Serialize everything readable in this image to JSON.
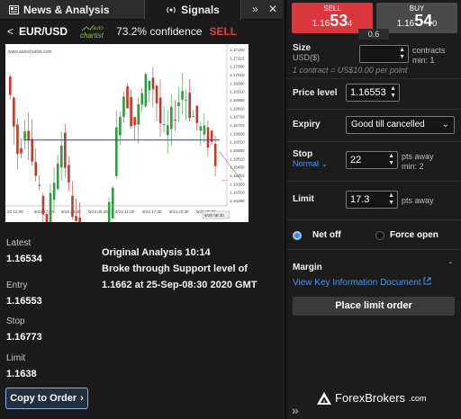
{
  "tabs": {
    "news": "News & Analysis",
    "signals": "Signals",
    "collapse": "»",
    "close": "✕"
  },
  "signal": {
    "back": "<",
    "pair": "EUR/USD",
    "logo_top": "auto",
    "logo_bottom": "chartist",
    "confidence": "73.2% confidence",
    "direction": "SELL"
  },
  "chart": {
    "watermark": "www.autochartist.com",
    "x_labels": [
      "23 12:00",
      "9/23 17:30",
      "9/23 23:30",
      "9/24 05:30",
      "9/24 11:30",
      "9/24 17:30",
      "9/24 23:30",
      "9/25 05:30"
    ],
    "y_labels": [
      "1.17160",
      "1.17110",
      "1.17060",
      "1.17010",
      "1.16960",
      "1.16910",
      "1.16860",
      "1.16810",
      "1.16760",
      "1.16710",
      "1.16660",
      "1.16610",
      "1.16560",
      "1.16510",
      "1.16460",
      "1.16410",
      "1.16360",
      "1.16310",
      "1.16260"
    ],
    "cursor_label": "9/25 08:30"
  },
  "stats": [
    {
      "label": "Latest",
      "value": "1.16534"
    },
    {
      "label": "Entry",
      "value": "1.16553"
    },
    {
      "label": "Stop",
      "value": "1.16773"
    },
    {
      "label": "Limit",
      "value": "1.1638"
    }
  ],
  "analysis": {
    "title": "Original Analysis 10:14",
    "body": "Broke through Support level of 1.1662 at 25-Sep-08:30 2020 GMT"
  },
  "copy_button": "Copy to Order",
  "ticket": {
    "sell": {
      "label": "SELL",
      "small": "1.16",
      "big": "53",
      "tiny": "4"
    },
    "buy": {
      "label": "BUY",
      "small": "1.16",
      "big": "54",
      "tiny": "0"
    },
    "spread": "0.6",
    "size": {
      "label": "Size",
      "unit": "USD($)",
      "value": "",
      "hint": "contracts min: 1",
      "note": "1 contract = US$10.00 per point"
    },
    "price_level": {
      "label": "Price level",
      "value": "1.16553"
    },
    "expiry": {
      "label": "Expiry",
      "value": "Good till cancelled"
    },
    "stop": {
      "label": "Stop",
      "type": "Normal",
      "value": "22",
      "hint": "pts away min: 2"
    },
    "limit": {
      "label": "Limit",
      "value": "17.3",
      "hint": "pts away"
    },
    "net_off": "Net off",
    "force_open": "Force open",
    "margin": {
      "label": "Margin",
      "value": "-"
    },
    "kid_link": "View Key Information Document",
    "place_button": "Place limit order"
  },
  "brand": {
    "name": "ForexBrokers",
    "suffix": ".com"
  },
  "colors": {
    "sell": "#d9373b",
    "buy": "#4a4a4a",
    "accent": "#3d8fe0",
    "link": "#4f94e5",
    "support_line": "#2c3ec9"
  }
}
